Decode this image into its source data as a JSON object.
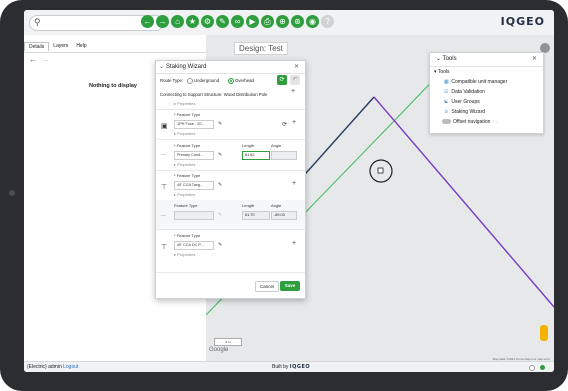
{
  "topbar": {
    "search": {
      "value": "",
      "placeholder": ""
    },
    "tools": [
      "back-icon",
      "forward-icon",
      "home-icon",
      "star-icon",
      "gear-icon",
      "pencil-icon",
      "link-icon",
      "measure-icon",
      "print-icon",
      "network-icon",
      "trace-icon",
      "camera-icon",
      "help-icon"
    ],
    "logo": "IQGEO"
  },
  "left_panel": {
    "tabs": [
      "Details",
      "Layers",
      "Help"
    ],
    "empty_message": "Nothing to display"
  },
  "map": {
    "design_title": "Design: Test",
    "scale_label": "5 m",
    "google_label": "Google",
    "map_data_label": "Map data ©2024  Terms  Report a map error"
  },
  "tools_panel": {
    "title": "Tools",
    "root": "Tools",
    "items": [
      {
        "label": "Compatible unit manager",
        "icon": "units-icon"
      },
      {
        "label": "Data Validation",
        "icon": "validation-icon"
      },
      {
        "label": "User Groups",
        "icon": "groups-icon"
      },
      {
        "label": "Staking Wizard",
        "icon": "staking-icon"
      },
      {
        "label": "Offset navigation",
        "icon": "toggle-icon"
      }
    ]
  },
  "wizard": {
    "title": "Staking Wizard",
    "route_type_label": "Route Type:",
    "route_options": [
      "Underground",
      "Overhead"
    ],
    "route_selected": "Overhead",
    "connecting_text": "Connecting to Support Structure: Wood Distribution Pole",
    "properties_label": "Properties",
    "feature_type_label": "* Feature Type",
    "feature_type_label_plain": "Feature Type",
    "length_label": "Length",
    "angle_label": "Angle",
    "rows": [
      {
        "feature": "1PH Fuse - 20..."
      },
      {
        "feature": "Primary Cond...",
        "length": "61.62",
        "angle": ""
      },
      {
        "feature": "45' CCA Tang..."
      },
      {
        "feature": "",
        "length": "61.70",
        "angle": "-89.03"
      },
      {
        "feature": "40' CCA DC P..."
      }
    ],
    "row_icons": [
      "fuse-icon",
      "conductor-icon",
      "pole-icon",
      "conductor-icon",
      "pole-icon"
    ],
    "cancel_label": "Cancel",
    "save_label": "Save"
  },
  "statusbar": {
    "user": "(Electric) admin",
    "user_link": "Logout",
    "built_by": "Built by",
    "built_by_brand": "IQGEO"
  },
  "colors": {
    "accent": "#2e9e3e",
    "route_dark": "#243a5e",
    "route_green": "#3dbb5c",
    "route_purple": "#7a3ac9"
  }
}
